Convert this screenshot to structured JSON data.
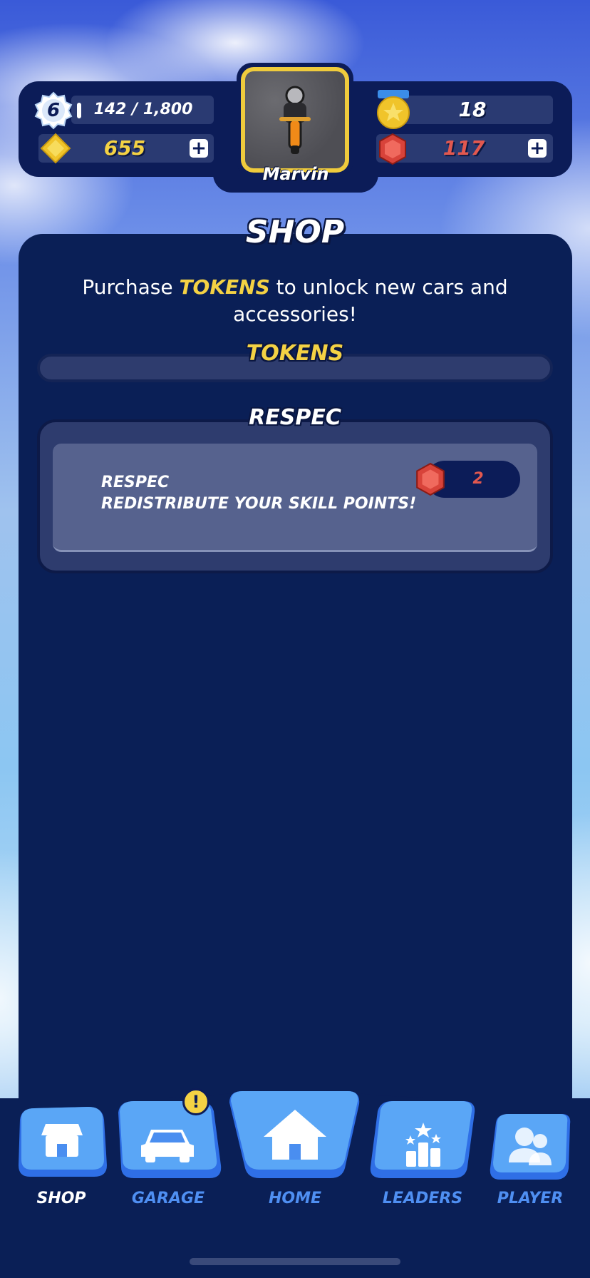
{
  "hud": {
    "level": "6",
    "xp": "142 / 1,800",
    "cash": "655",
    "stars": "18",
    "gems": "117",
    "player_name": "Marvin",
    "plus_label": "+"
  },
  "shop": {
    "title": "SHOP",
    "intro_before": "Purchase ",
    "intro_highlight": "TOKENS",
    "intro_after": " to unlock new cars and accessories!",
    "tokens_label": "TOKENS",
    "respec_section_label": "RESPEC",
    "respec_item": {
      "title": "RESPEC",
      "description": "REDISTRIBUTE YOUR SKILL POINTS!",
      "price": "2"
    }
  },
  "nav": {
    "items": [
      {
        "label": "SHOP",
        "icon": "shop-icon",
        "active": true
      },
      {
        "label": "GARAGE",
        "icon": "car-icon",
        "active": false,
        "alert": "!"
      },
      {
        "label": "HOME",
        "icon": "home-icon",
        "active": false
      },
      {
        "label": "LEADERS",
        "icon": "podium-icon",
        "active": false
      },
      {
        "label": "PLAYER",
        "icon": "players-icon",
        "active": false
      }
    ]
  },
  "colors": {
    "panel": "#0a1f56",
    "accent_yellow": "#f4d244",
    "gem_red": "#e2584f",
    "nav_blue": "#4f8ff2"
  }
}
